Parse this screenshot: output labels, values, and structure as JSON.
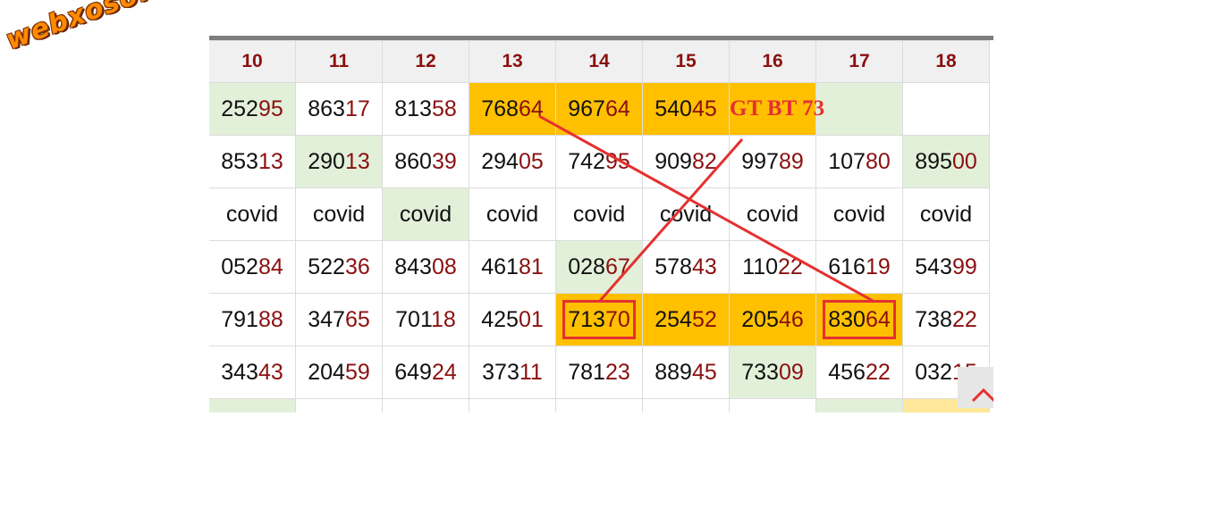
{
  "logo_text": "webxoso.net",
  "annotation_text": "GT BT 73",
  "colors": {
    "accent_red": "#e53030",
    "digit_red": "#8b1010",
    "orange": "#ffc000",
    "green": "#e2f0d9"
  },
  "table": {
    "headers": [
      "10",
      "11",
      "12",
      "13",
      "14",
      "15",
      "16",
      "17",
      "18"
    ],
    "rows": [
      [
        {
          "a": "252",
          "b": "95",
          "bg": "green"
        },
        {
          "a": "863",
          "b": "17"
        },
        {
          "a": "813",
          "b": "58"
        },
        {
          "a": "768",
          "b": "64",
          "bg": "orange"
        },
        {
          "a": "967",
          "b": "64",
          "bg": "orange"
        },
        {
          "a": "540",
          "b": "45",
          "bg": "orange"
        },
        {
          "a": "",
          "b": "",
          "bg": "orange"
        },
        {
          "a": "",
          "b": "",
          "bg": "green"
        },
        {
          "a": "",
          "b": ""
        }
      ],
      [
        {
          "a": "853",
          "b": "13"
        },
        {
          "a": "290",
          "b": "13",
          "bg": "green"
        },
        {
          "a": "860",
          "b": "39"
        },
        {
          "a": "294",
          "b": "05"
        },
        {
          "a": "742",
          "b": "95"
        },
        {
          "a": "909",
          "b": "82"
        },
        {
          "a": "997",
          "b": "89"
        },
        {
          "a": "107",
          "b": "80"
        },
        {
          "a": "895",
          "b": "00",
          "bg": "green"
        }
      ],
      [
        {
          "a": "covid",
          "b": ""
        },
        {
          "a": "covid",
          "b": ""
        },
        {
          "a": "covid",
          "b": "",
          "bg": "green"
        },
        {
          "a": "covid",
          "b": ""
        },
        {
          "a": "covid",
          "b": ""
        },
        {
          "a": "covid",
          "b": ""
        },
        {
          "a": "covid",
          "b": ""
        },
        {
          "a": "covid",
          "b": ""
        },
        {
          "a": "covid",
          "b": ""
        }
      ],
      [
        {
          "a": "052",
          "b": "84"
        },
        {
          "a": "522",
          "b": "36"
        },
        {
          "a": "843",
          "b": "08"
        },
        {
          "a": "461",
          "b": "81"
        },
        {
          "a": "028",
          "b": "67",
          "bg": "green"
        },
        {
          "a": "578",
          "b": "43"
        },
        {
          "a": "110",
          "b": "22"
        },
        {
          "a": "616",
          "b": "19"
        },
        {
          "a": "543",
          "b": "99"
        }
      ],
      [
        {
          "a": "791",
          "b": "88"
        },
        {
          "a": "347",
          "b": "65"
        },
        {
          "a": "701",
          "b": "18"
        },
        {
          "a": "425",
          "b": "01"
        },
        {
          "a": "713",
          "b": "70",
          "bg": "orange",
          "boxed": true
        },
        {
          "a": "254",
          "b": "52",
          "bg": "orange"
        },
        {
          "a": "205",
          "b": "46",
          "bg": "orange"
        },
        {
          "a": "830",
          "b": "64",
          "bg": "orange",
          "boxed": true
        },
        {
          "a": "738",
          "b": "22"
        }
      ],
      [
        {
          "a": "343",
          "b": "43"
        },
        {
          "a": "204",
          "b": "59"
        },
        {
          "a": "649",
          "b": "24"
        },
        {
          "a": "373",
          "b": "11"
        },
        {
          "a": "781",
          "b": "23"
        },
        {
          "a": "889",
          "b": "45"
        },
        {
          "a": "733",
          "b": "09",
          "bg": "green"
        },
        {
          "a": "456",
          "b": "22"
        },
        {
          "a": "032",
          "b": "15"
        }
      ],
      [
        {
          "a": "",
          "b": "",
          "bg": "green"
        },
        {
          "a": "",
          "b": ""
        },
        {
          "a": "",
          "b": ""
        },
        {
          "a": "",
          "b": ""
        },
        {
          "a": "",
          "b": ""
        },
        {
          "a": "",
          "b": ""
        },
        {
          "a": "",
          "b": ""
        },
        {
          "a": "",
          "b": "",
          "bg": "green"
        },
        {
          "a": "",
          "b": "",
          "bg": "lightorange"
        }
      ]
    ]
  },
  "scroll_top_icon": "chevron-up-icon"
}
